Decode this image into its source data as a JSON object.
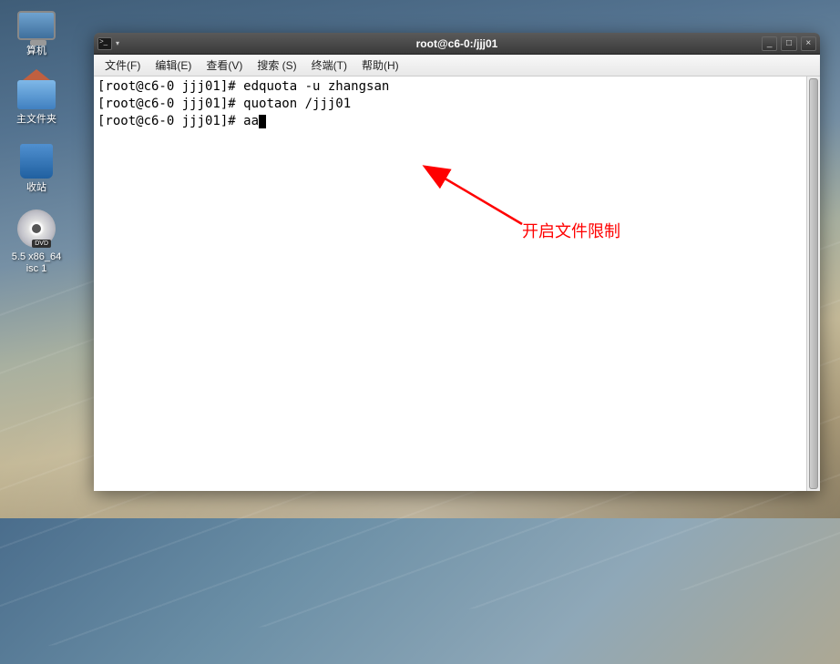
{
  "desktop": {
    "icons": [
      {
        "name": "computer-icon",
        "label": "算机"
      },
      {
        "name": "home-folder-icon",
        "label": "主文件夹"
      },
      {
        "name": "trash-icon",
        "label": "收站"
      },
      {
        "name": "dvd-icon",
        "label": "5.5 x86_64\nisc 1",
        "badge": "DVD"
      }
    ]
  },
  "window": {
    "title": "root@c6-0:/jjj01",
    "menus": {
      "file": "文件(F)",
      "edit": "编辑(E)",
      "view": "查看(V)",
      "search": "搜索 (S)",
      "terminal": "终端(T)",
      "help": "帮助(H)"
    },
    "controls": {
      "min": "_",
      "max": "□",
      "close": "×"
    }
  },
  "terminal": {
    "lines": [
      {
        "prompt": "[root@c6-0 jjj01]# ",
        "cmd": "edquota -u zhangsan"
      },
      {
        "prompt": "[root@c6-0 jjj01]# ",
        "cmd": "quotaon /jjj01"
      },
      {
        "prompt": "[root@c6-0 jjj01]# ",
        "cmd": "aa",
        "cursor": true
      }
    ]
  },
  "annotation": {
    "text": "开启文件限制",
    "color": "#ff0000"
  }
}
